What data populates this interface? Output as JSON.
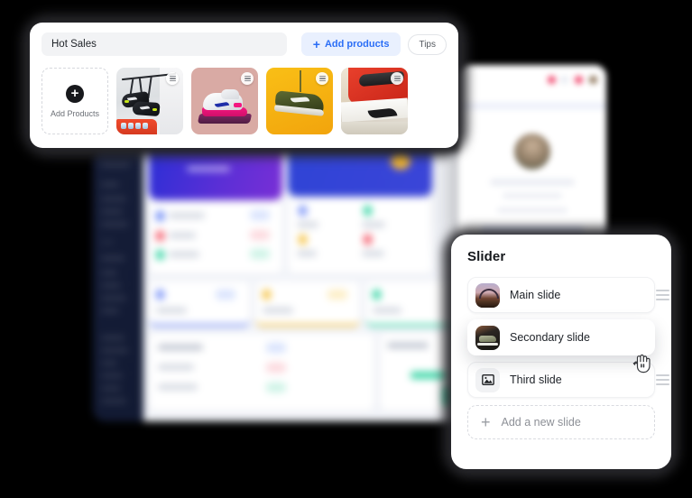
{
  "products_panel": {
    "title_value": "Hot Sales",
    "title_placeholder": "Collection name",
    "add_products_label": "Add products",
    "tips_label": "Tips",
    "add_card_label": "Add Products",
    "cards": [
      {
        "name": "black-sneakers-hanging",
        "alt": "Black Nike sneakers hanging from a rack"
      },
      {
        "name": "pink-white-airmax",
        "alt": "White and pink Nike Air Max on purple stand"
      },
      {
        "name": "olive-running-shoe",
        "alt": "Olive green Nike running shoe on yellow background"
      },
      {
        "name": "red-black-jordan",
        "alt": "Red black and white Jordan 1 sneaker close-up"
      }
    ]
  },
  "slider_panel": {
    "title": "Slider",
    "slides": [
      {
        "label": "Main slide",
        "thumb": "paraglider-sunset-photo",
        "dragging": false
      },
      {
        "label": "Secondary slide",
        "thumb": "sneaker-dark-photo",
        "dragging": true
      },
      {
        "label": "Third slide",
        "thumb": "image-placeholder-icon",
        "dragging": false
      }
    ],
    "add_slide_label": "Add a new slide"
  },
  "colors": {
    "accent_blue": "#2b6ef6",
    "accent_blue_bg": "#e9f0fe",
    "panel_white": "#ffffff",
    "canvas_black": "#000000",
    "input_gray": "#f2f3f5",
    "dashed_border": "#d6d8dd"
  }
}
